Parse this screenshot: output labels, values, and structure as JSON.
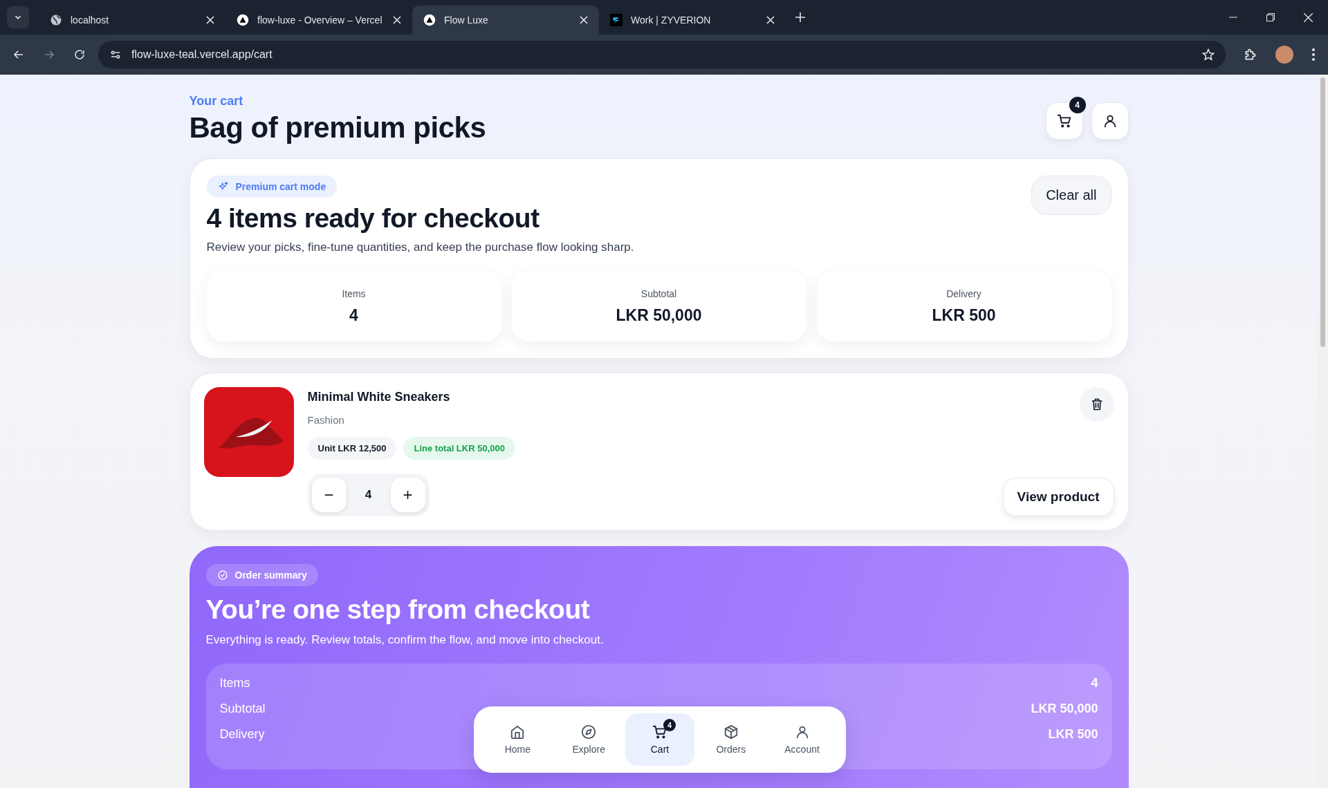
{
  "browser": {
    "tabs": [
      {
        "title": "localhost",
        "kind": "globe",
        "selected": false
      },
      {
        "title": "flow-luxe - Overview – Vercel",
        "kind": "triangle",
        "selected": false
      },
      {
        "title": "Flow Luxe",
        "kind": "triangle",
        "selected": true
      },
      {
        "title": "Work | ZYVERION",
        "kind": "brand",
        "selected": false
      }
    ],
    "address": "flow-luxe-teal.vercel.app/cart"
  },
  "header": {
    "eyebrow": "Your cart",
    "title": "Bag of premium picks",
    "cart_count": "4"
  },
  "hero": {
    "badge": "Premium cart mode",
    "title": "4 items ready for checkout",
    "description": "Review your picks, fine-tune quantities, and keep the purchase flow looking sharp.",
    "clear_button": "Clear all",
    "stats": [
      {
        "label": "Items",
        "value": "4"
      },
      {
        "label": "Subtotal",
        "value": "LKR 50,000"
      },
      {
        "label": "Delivery",
        "value": "LKR 500"
      }
    ]
  },
  "cart_items": [
    {
      "name": "Minimal White Sneakers",
      "category": "Fashion",
      "unit": "Unit LKR 12,500",
      "line_total": "Line total LKR 50,000",
      "quantity": "4",
      "decrease": "−",
      "increase": "+",
      "view_button": "View product"
    }
  ],
  "summary": {
    "badge": "Order summary",
    "title": "You’re one step from checkout",
    "description": "Everything is ready. Review totals, confirm the flow, and move into checkout.",
    "rows": [
      {
        "label": "Items",
        "value": "4"
      },
      {
        "label": "Subtotal",
        "value": "LKR 50,000"
      },
      {
        "label": "Delivery",
        "value": "LKR 500"
      }
    ]
  },
  "bottom_nav": [
    {
      "label": "Home",
      "kind": "home",
      "selected": false
    },
    {
      "label": "Explore",
      "kind": "compass",
      "selected": false
    },
    {
      "label": "Cart",
      "kind": "cart",
      "selected": true,
      "badge": "4"
    },
    {
      "label": "Orders",
      "kind": "box",
      "selected": false
    },
    {
      "label": "Account",
      "kind": "user",
      "selected": false
    }
  ]
}
